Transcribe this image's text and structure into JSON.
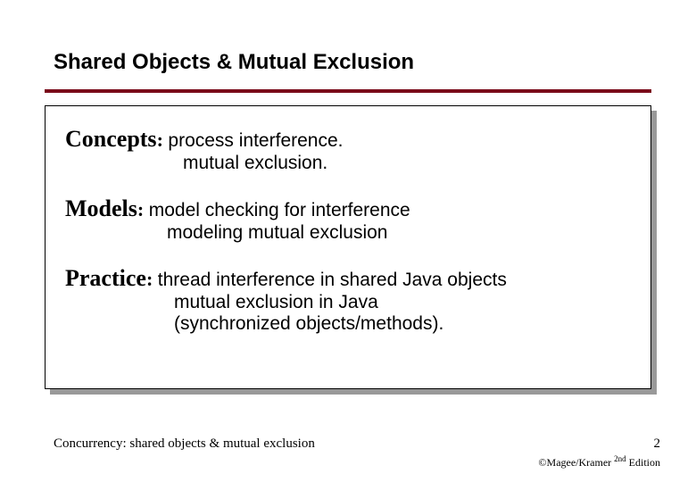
{
  "title": "Shared Objects & Mutual Exclusion",
  "sections": {
    "concepts": {
      "label": "Concepts",
      "line1": "process interference.",
      "line2": "mutual exclusion."
    },
    "models": {
      "label": "Models",
      "line1": "model checking for interference",
      "line2": "modeling mutual exclusion"
    },
    "practice": {
      "label": "Practice",
      "line1": "thread interference in shared Java objects",
      "line2": "mutual exclusion in Java",
      "line3": "(synchronized objects/methods)."
    }
  },
  "footer": {
    "left": "Concurrency: shared objects & mutual exclusion",
    "pageNumber": "2",
    "copyright_prefix": "©Magee/Kramer ",
    "copyright_sup": "2nd",
    "copyright_suffix": " Edition"
  }
}
